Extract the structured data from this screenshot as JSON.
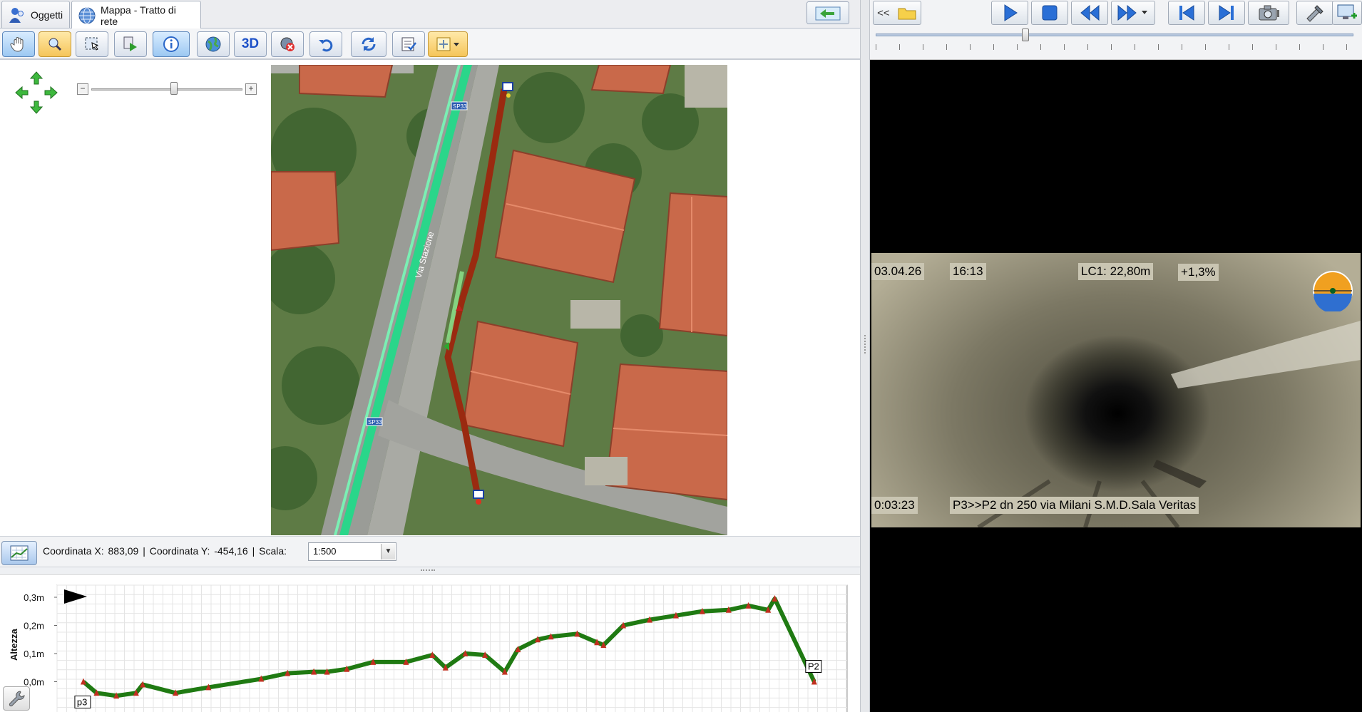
{
  "tabs": [
    {
      "label": "Oggetti",
      "icon": "users-icon"
    },
    {
      "label": "Mappa - Tratto di rete",
      "icon": "globe-icon"
    }
  ],
  "map_toolbar": {
    "buttons": [
      {
        "icon": "hand-pan-icon",
        "state": "active"
      },
      {
        "icon": "magnifier-icon",
        "state": "highlighted"
      },
      {
        "icon": "select-area-icon"
      },
      {
        "icon": "play-route-icon"
      },
      {
        "icon": "info-icon",
        "state": "active"
      },
      {
        "icon": "globe-icon"
      },
      {
        "icon": "3d-icon",
        "label": "3D"
      },
      {
        "icon": "cancel-globe-icon"
      },
      {
        "icon": "undo-icon"
      },
      {
        "icon": "refresh-icon"
      },
      {
        "icon": "checklist-icon"
      },
      {
        "icon": "layer-dropdown-icon"
      }
    ]
  },
  "map": {
    "road_labels": [
      "SP33",
      "SP33",
      "Via Stazione"
    ],
    "zoom_level": 0.55
  },
  "status": {
    "coord_x_label": "Coordinata X:",
    "coord_x": "883,09",
    "coord_y_label": "Coordinata Y:",
    "coord_y": "-454,16",
    "scale_label": "Scala:",
    "scale_value": "1:500"
  },
  "chart_data": {
    "type": "line",
    "ylabel": "Altezza",
    "yticks": [
      "0,3m",
      "0,2m",
      "0,1m",
      "0,0m"
    ],
    "ylim": [
      -0.1,
      0.3
    ],
    "start_label": "p3",
    "end_label": "P2",
    "series": [
      {
        "x": [
          0,
          2,
          5,
          8,
          9,
          14,
          19,
          27,
          31,
          35,
          37,
          40,
          44,
          49,
          53,
          55,
          58,
          61,
          64,
          66,
          69,
          71,
          75,
          78,
          79,
          82,
          86,
          90,
          94,
          98,
          101,
          104,
          105,
          111
        ],
        "values": [
          0.0,
          -0.04,
          -0.05,
          -0.04,
          -0.01,
          -0.04,
          -0.02,
          0.01,
          0.03,
          0.035,
          0.035,
          0.045,
          0.07,
          0.07,
          0.095,
          0.05,
          0.1,
          0.095,
          0.035,
          0.115,
          0.15,
          0.16,
          0.17,
          0.14,
          0.13,
          0.2,
          0.22,
          0.235,
          0.25,
          0.255,
          0.27,
          0.255,
          0.295,
          0.0
        ]
      }
    ],
    "grid": true,
    "color": "#1f7a12",
    "marker_color": "#c03020"
  },
  "video_toolbar": {
    "back_label": "<<",
    "buttons": [
      "folder-icon",
      "play-icon",
      "stop-icon",
      "rewind-icon",
      "fast-forward-icon",
      "speed-dropdown-icon",
      "previous-icon",
      "next-icon",
      "camera-icon",
      "tools-icon",
      "add-monitor-icon"
    ],
    "position": 0.31
  },
  "video_osd": {
    "date": "03.04.26",
    "time": "16:13",
    "distance": "LC1: 22,80m",
    "slope": "+1,3%",
    "elapsed": "0:03:23",
    "description": "P3>>P2 dn 250  via Milani S.M.D.Sala Veritas"
  },
  "colors": {
    "pipe": "#9a2a10",
    "road_overlay": "#2ad68a",
    "profile_line": "#1f7a12"
  }
}
